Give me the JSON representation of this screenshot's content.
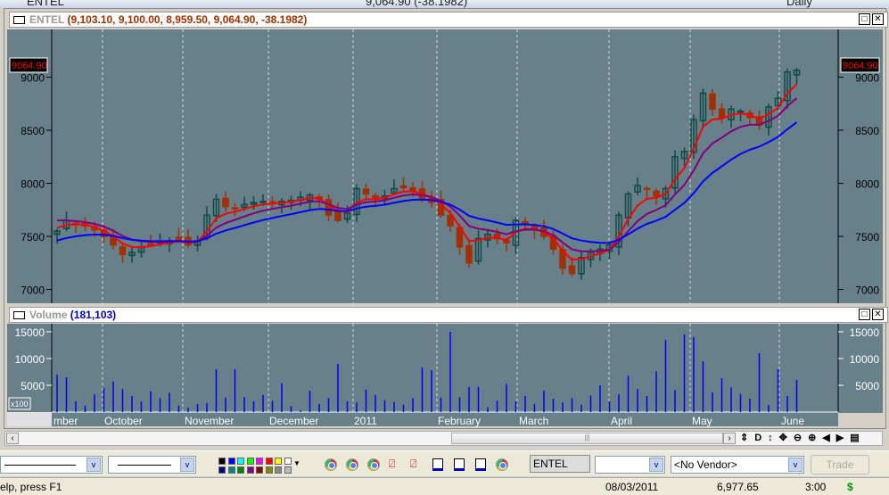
{
  "title_bar": {
    "symbol": "ENTEL",
    "quote": "9,064.90 (-38.1982)",
    "period": "Daily"
  },
  "price_panel": {
    "symbol": "ENTEL",
    "values": "(9,103.10, 9,100.00, 8,959.50, 9,064.90, -38.1982)",
    "last_price_label": "9064.90",
    "y_ticks": [
      "9000",
      "8500",
      "8000",
      "7500",
      "7000"
    ]
  },
  "volume_panel": {
    "name": "Volume",
    "value": "(181,103)",
    "multiplier": "x100",
    "y_ticks": [
      "15000",
      "10000",
      "5000"
    ]
  },
  "x_axis_labels": [
    "mber",
    "October",
    "November",
    "December",
    "2011",
    "February",
    "March",
    "April",
    "May",
    "June"
  ],
  "toolbar": {
    "symbol_field": "ENTEL",
    "vendor_select": "<No Vendor>",
    "trade_button": "Trade"
  },
  "status_bar": {
    "help": "elp, press F1",
    "date": "08/03/2011",
    "value": "6,977.65",
    "time": "3:00",
    "currency": "$"
  },
  "colors": {
    "up": "#0f4a44",
    "down": "#a33000",
    "ma_fast": "#ff0000",
    "ma_mid": "#800080",
    "ma_slow": "#0000ff",
    "plot_bg": "#67808a",
    "volume": "#0000ff"
  },
  "chart_data": {
    "type": "candlestick",
    "closes": [
      7550,
      7650,
      7620,
      7600,
      7560,
      7500,
      7420,
      7330,
      7350,
      7400,
      7420,
      7450,
      7460,
      7470,
      7420,
      7460,
      7700,
      7850,
      7780,
      7760,
      7800,
      7820,
      7830,
      7820,
      7830,
      7840,
      7870,
      7890,
      7850,
      7700,
      7650,
      7720,
      7950,
      7900,
      7850,
      7880,
      7950,
      7960,
      7930,
      7860,
      7820,
      7700,
      7600,
      7400,
      7250,
      7480,
      7520,
      7480,
      7440,
      7650,
      7620,
      7560,
      7500,
      7380,
      7200,
      7150,
      7300,
      7350,
      7380,
      7420,
      7700,
      7900,
      7980,
      7950,
      7880,
      7950,
      8250,
      8300,
      8600,
      8850,
      8700,
      8620,
      8700,
      8680,
      8620,
      8550,
      8720,
      8800,
      9050,
      9064.9
    ],
    "volume": [
      7000,
      6500,
      2000,
      1200,
      3300,
      4500,
      5700,
      4300,
      3000,
      2000,
      3900,
      2600,
      3600,
      1200,
      800,
      1500,
      1700,
      8000,
      2700,
      8000,
      2800,
      2000,
      3200,
      2100,
      5400,
      1100,
      300,
      4000,
      1500,
      2600,
      9000,
      2000,
      1800,
      4200,
      3200,
      2200,
      1900,
      1400,
      2600,
      8300,
      7800,
      2700,
      15000,
      2800,
      4700,
      4700,
      900,
      2100,
      5200,
      2000,
      3000,
      1500,
      4000,
      2500,
      1800,
      2600,
      1400,
      3100,
      5000,
      2000,
      3300,
      6800,
      4300,
      3000,
      7600,
      13500,
      4100,
      14500,
      14000,
      9500,
      3700,
      6300,
      4600,
      3400,
      2500,
      11000,
      1300,
      8000,
      3000,
      6000
    ],
    "price_range": [
      6870,
      9450
    ],
    "volume_range": [
      0,
      16500
    ]
  }
}
